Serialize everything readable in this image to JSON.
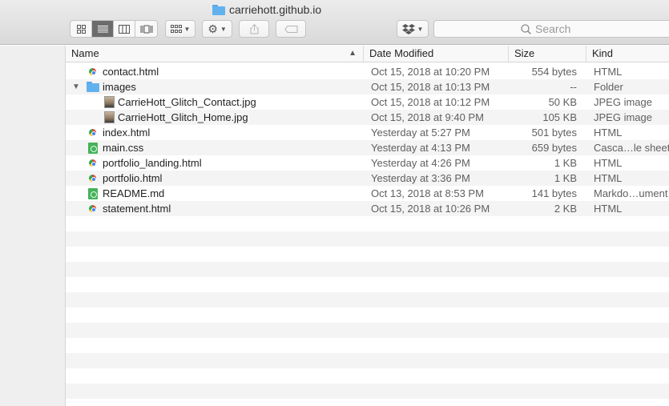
{
  "window": {
    "title": "carriehott.github.io"
  },
  "toolbar": {
    "search_placeholder": "Search"
  },
  "columns": {
    "name": "Name",
    "date": "Date Modified",
    "size": "Size",
    "kind": "Kind"
  },
  "files": [
    {
      "name": "contact.html",
      "date": "Oct 15, 2018 at 10:20 PM",
      "size": "554 bytes",
      "kind": "HTML",
      "icon": "chrome-html-icon"
    },
    {
      "name": "images",
      "date": "Oct 15, 2018 at 10:13 PM",
      "size": "--",
      "kind": "Folder",
      "icon": "folder-icon"
    },
    {
      "name": "CarrieHott_Glitch_Contact.jpg",
      "date": "Oct 15, 2018 at 10:12 PM",
      "size": "50 KB",
      "kind": "JPEG image",
      "icon": "jpeg-thumbnail-icon"
    },
    {
      "name": "CarrieHott_Glitch_Home.jpg",
      "date": "Oct 15, 2018 at 9:40 PM",
      "size": "105 KB",
      "kind": "JPEG image",
      "icon": "jpeg-thumbnail-icon"
    },
    {
      "name": "index.html",
      "date": "Yesterday at 5:27 PM",
      "size": "501 bytes",
      "kind": "HTML",
      "icon": "chrome-html-icon"
    },
    {
      "name": "main.css",
      "date": "Yesterday at 4:13 PM",
      "size": "659 bytes",
      "kind": "Casca…le sheet",
      "icon": "css-document-icon"
    },
    {
      "name": "portfolio_landing.html",
      "date": "Yesterday at 4:26 PM",
      "size": "1 KB",
      "kind": "HTML",
      "icon": "chrome-html-icon"
    },
    {
      "name": "portfolio.html",
      "date": "Yesterday at 3:36 PM",
      "size": "1 KB",
      "kind": "HTML",
      "icon": "chrome-html-icon"
    },
    {
      "name": "README.md",
      "date": "Oct 13, 2018 at 8:53 PM",
      "size": "141 bytes",
      "kind": "Markdo…ument",
      "icon": "markdown-document-icon"
    },
    {
      "name": "statement.html",
      "date": "Oct 15, 2018 at 10:26 PM",
      "size": "2 KB",
      "kind": "HTML",
      "icon": "chrome-html-icon"
    }
  ]
}
